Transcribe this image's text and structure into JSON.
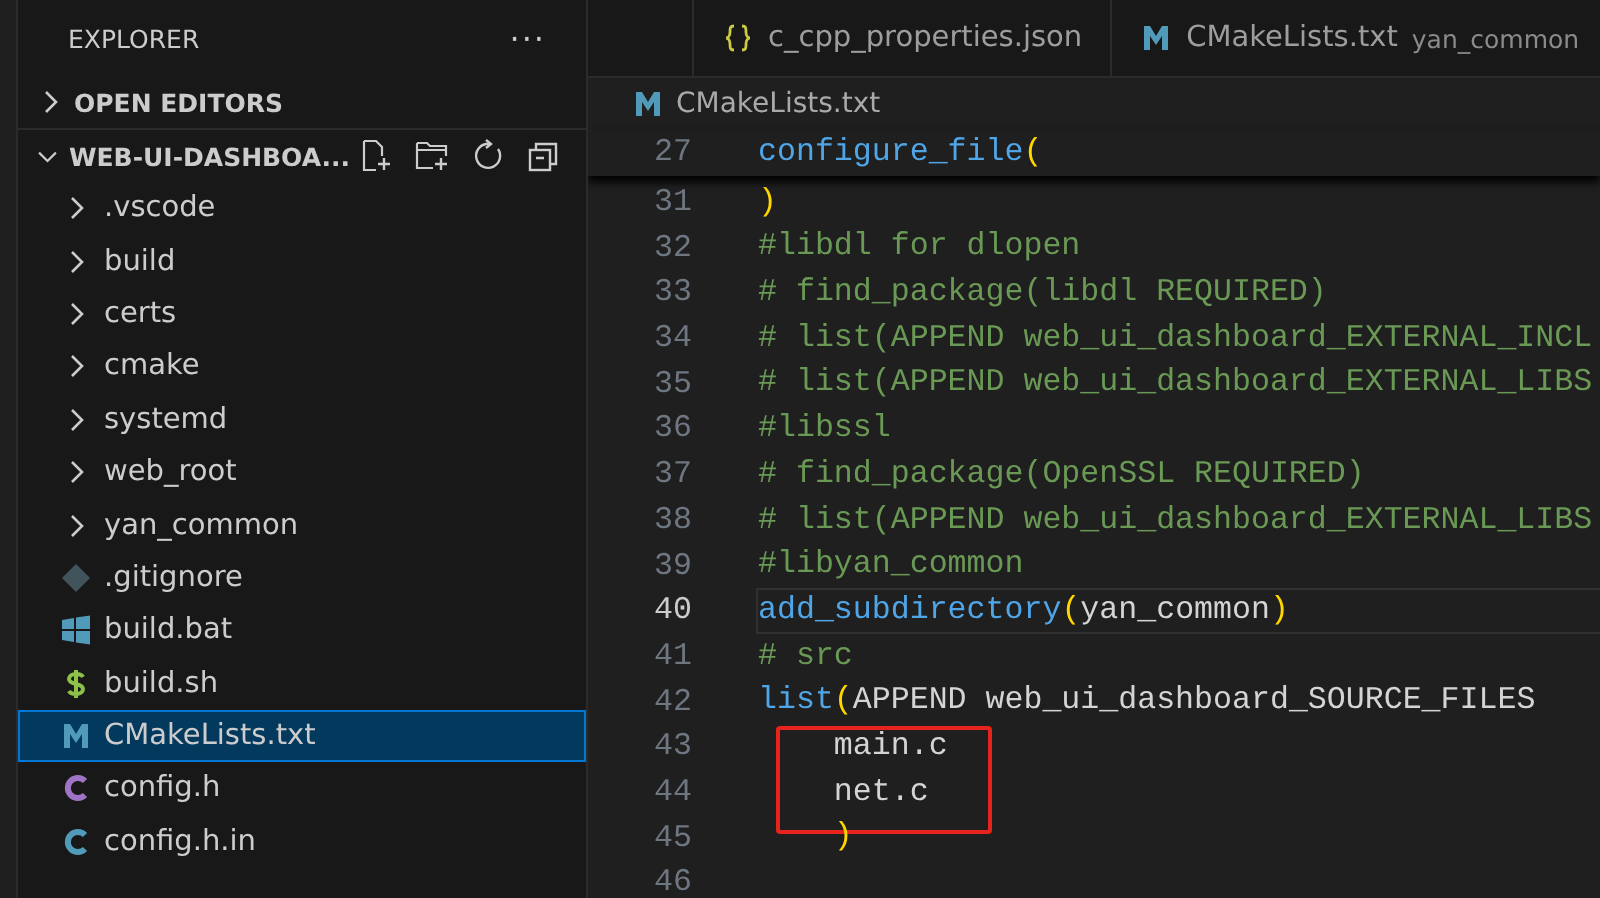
{
  "sidebar": {
    "title": "EXPLORER",
    "more": "···",
    "sections": [
      {
        "label": "OPEN EDITORS",
        "expanded": false
      },
      {
        "label": "WEB-UI-DASHBOA...",
        "expanded": true
      }
    ],
    "items": [
      {
        "label": ".vscode",
        "kind": "folder",
        "expanded": false,
        "selected": false
      },
      {
        "label": "build",
        "kind": "folder",
        "expanded": false,
        "selected": false
      },
      {
        "label": "certs",
        "kind": "folder",
        "expanded": false,
        "selected": false
      },
      {
        "label": "cmake",
        "kind": "folder",
        "expanded": false,
        "selected": false
      },
      {
        "label": "systemd",
        "kind": "folder",
        "expanded": false,
        "selected": false
      },
      {
        "label": "web_root",
        "kind": "folder",
        "expanded": false,
        "selected": false
      },
      {
        "label": "yan_common",
        "kind": "folder",
        "expanded": false,
        "selected": false
      },
      {
        "label": ".gitignore",
        "kind": "git",
        "selected": false
      },
      {
        "label": "build.bat",
        "kind": "windows",
        "selected": false
      },
      {
        "label": "build.sh",
        "kind": "shell",
        "selected": false
      },
      {
        "label": "CMakeLists.txt",
        "kind": "cmake",
        "selected": true
      },
      {
        "label": "config.h",
        "kind": "c-header",
        "selected": false
      },
      {
        "label": "config.h.in",
        "kind": "c-source",
        "selected": false
      }
    ]
  },
  "tabs": [
    {
      "label": "c_cpp_properties.json",
      "kind": "json",
      "selected": false
    },
    {
      "label": "CMakeLists.txt",
      "description": "yan_common",
      "kind": "cmake",
      "selected": false
    }
  ],
  "breadcrumb": {
    "label": "CMakeLists.txt",
    "kind": "cmake"
  },
  "sticky_line": {
    "number": "27",
    "tokens": [
      {
        "text": "configure_file",
        "kind": "func"
      },
      {
        "text": "(",
        "kind": "paren"
      }
    ]
  },
  "lines": [
    {
      "number": "31",
      "current": false,
      "annotated": false,
      "tokens": [
        {
          "text": ")",
          "kind": "paren"
        }
      ]
    },
    {
      "number": "32",
      "current": false,
      "annotated": false,
      "tokens": [
        {
          "text": "#libdl for dlopen",
          "kind": "comment"
        }
      ]
    },
    {
      "number": "33",
      "current": false,
      "annotated": false,
      "tokens": [
        {
          "text": "# find_package(libdl REQUIRED)",
          "kind": "comment"
        }
      ]
    },
    {
      "number": "34",
      "current": false,
      "annotated": false,
      "tokens": [
        {
          "text": "# list(APPEND web_ui_dashboard_EXTERNAL_INCL",
          "kind": "comment"
        }
      ]
    },
    {
      "number": "35",
      "current": false,
      "annotated": false,
      "tokens": [
        {
          "text": "# list(APPEND web_ui_dashboard_EXTERNAL_LIBS",
          "kind": "comment"
        }
      ]
    },
    {
      "number": "36",
      "current": false,
      "annotated": false,
      "tokens": [
        {
          "text": "#libssl",
          "kind": "comment"
        }
      ]
    },
    {
      "number": "37",
      "current": false,
      "annotated": false,
      "tokens": [
        {
          "text": "# find_package(OpenSSL REQUIRED)",
          "kind": "comment"
        }
      ]
    },
    {
      "number": "38",
      "current": false,
      "annotated": false,
      "tokens": [
        {
          "text": "# list(APPEND web_ui_dashboard_EXTERNAL_LIBS",
          "kind": "comment"
        }
      ]
    },
    {
      "number": "39",
      "current": false,
      "annotated": false,
      "tokens": [
        {
          "text": "#libyan_common",
          "kind": "comment"
        }
      ]
    },
    {
      "number": "40",
      "current": true,
      "annotated": false,
      "tokens": [
        {
          "text": "add_subdirectory",
          "kind": "func"
        },
        {
          "text": "(",
          "kind": "paren"
        },
        {
          "text": "yan_common",
          "kind": "plain"
        },
        {
          "text": ")",
          "kind": "paren"
        }
      ]
    },
    {
      "number": "41",
      "current": false,
      "annotated": false,
      "tokens": [
        {
          "text": "# src",
          "kind": "comment"
        }
      ]
    },
    {
      "number": "42",
      "current": false,
      "annotated": false,
      "tokens": [
        {
          "text": "list",
          "kind": "func"
        },
        {
          "text": "(",
          "kind": "paren"
        },
        {
          "text": "APPEND web_ui_dashboard_SOURCE_FILES",
          "kind": "plain"
        }
      ]
    },
    {
      "number": "43",
      "current": false,
      "annotated": true,
      "tokens": [
        {
          "text": "    main.c",
          "kind": "plain"
        }
      ]
    },
    {
      "number": "44",
      "current": false,
      "annotated": false,
      "tokens": [
        {
          "text": "    net.c",
          "kind": "plain"
        }
      ]
    },
    {
      "number": "45",
      "current": false,
      "annotated": false,
      "tokens": [
        {
          "text": "    )",
          "kind": "paren"
        }
      ]
    },
    {
      "number": "46",
      "current": false,
      "annotated": false
    }
  ]
}
